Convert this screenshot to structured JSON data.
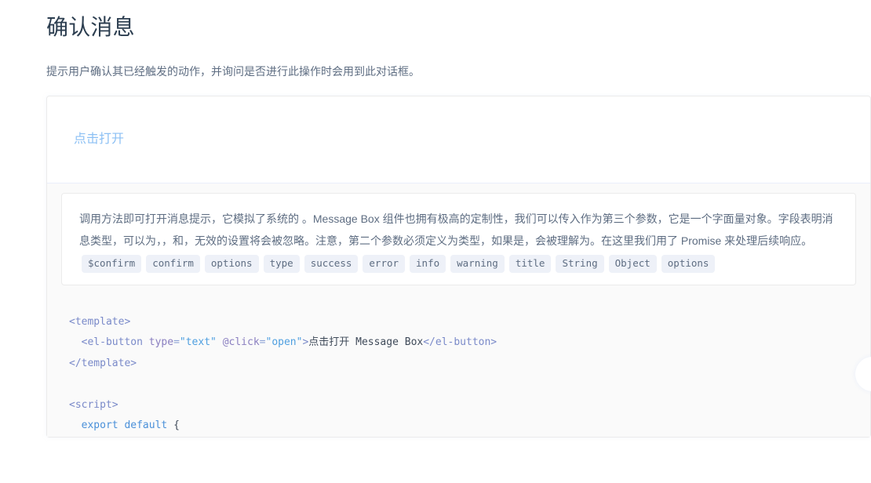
{
  "page": {
    "title": "确认消息",
    "description": "提示用户确认其已经触发的动作，并询问是否进行此操作时会用到此对话框。"
  },
  "demo": {
    "button_label": "点击打开"
  },
  "explanation": {
    "paragraph_part1": "调用方法即可打开消息提示，它模拟了系统的 。Message Box 组件也拥有极高的定制性，我们可以传入作为第三个参数，它是一个字面量对象。字段表明消息类型，可以为，，和，无效的设置将会被忽略。注意，第二个参数必须定义为类型，如果是，会被理解为。在这里我们用了 Promise 来处理后续响应。",
    "code_tokens": [
      "$confirm",
      "confirm",
      "options",
      "type",
      "success",
      "error",
      "info",
      "warning",
      "title",
      "String",
      "Object",
      "options"
    ]
  },
  "code": {
    "lines": [
      [
        {
          "t": "<template>",
          "c": "tag"
        }
      ],
      [
        {
          "t": "  ",
          "c": "plain"
        },
        {
          "t": "<el-button",
          "c": "tag"
        },
        {
          "t": " ",
          "c": "plain"
        },
        {
          "t": "type",
          "c": "attr"
        },
        {
          "t": "=",
          "c": "punc"
        },
        {
          "t": "\"text\"",
          "c": "str"
        },
        {
          "t": " ",
          "c": "plain"
        },
        {
          "t": "@click",
          "c": "attr"
        },
        {
          "t": "=",
          "c": "punc"
        },
        {
          "t": "\"open\"",
          "c": "str"
        },
        {
          "t": ">",
          "c": "tag"
        },
        {
          "t": "点击打开 Message Box",
          "c": "text"
        },
        {
          "t": "</el-button>",
          "c": "tag"
        }
      ],
      [
        {
          "t": "</template>",
          "c": "tag"
        }
      ],
      [],
      [
        {
          "t": "<script>",
          "c": "tag"
        }
      ],
      [
        {
          "t": "  ",
          "c": "plain"
        },
        {
          "t": "export",
          "c": "kw"
        },
        {
          "t": " ",
          "c": "plain"
        },
        {
          "t": "default",
          "c": "kw"
        },
        {
          "t": " ",
          "c": "plain"
        },
        {
          "t": "{",
          "c": "plain"
        }
      ]
    ]
  },
  "colors": {
    "accent": "#8cc0f4",
    "heading": "#2c3e50",
    "body_text": "#5e6d82",
    "badge_bg": "#eef1f8",
    "panel_bg": "#fafafa",
    "border": "#ebebeb"
  }
}
